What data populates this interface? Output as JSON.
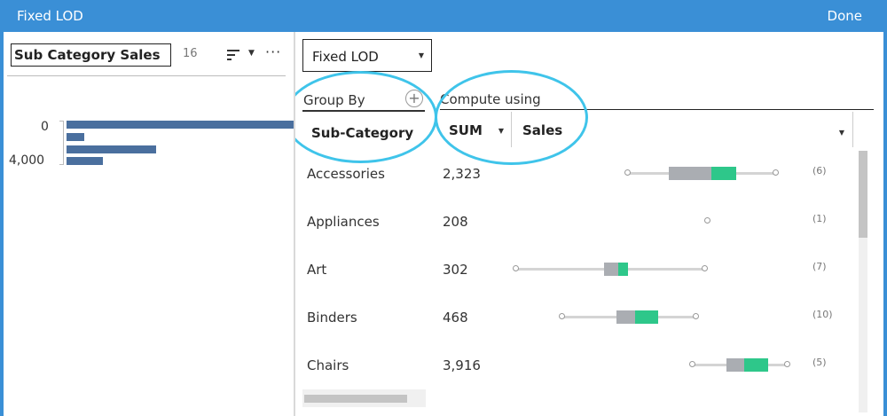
{
  "window": {
    "title": "Fixed LOD",
    "done_label": "Done"
  },
  "left_panel": {
    "field_name": "Sub Category Sales",
    "count": "16",
    "histogram": {
      "tick_labels": [
        "0",
        "4,000"
      ]
    }
  },
  "right_panel": {
    "lod_type": {
      "selected": "Fixed LOD"
    },
    "group_by": {
      "label": "Group By",
      "add_icon": "plus-circle-icon",
      "field": "Sub-Category"
    },
    "compute_using": {
      "label": "Compute using",
      "aggregation": "SUM",
      "field": "Sales"
    },
    "rows": [
      {
        "category": "Accessories",
        "value": "2,323",
        "count": "(6)"
      },
      {
        "category": "Appliances",
        "value": "208",
        "count": "(1)"
      },
      {
        "category": "Art",
        "value": "302",
        "count": "(7)"
      },
      {
        "category": "Binders",
        "value": "468",
        "count": "(10)"
      },
      {
        "category": "Chairs",
        "value": "3,916",
        "count": "(5)"
      }
    ]
  },
  "colors": {
    "titlebar": "#3a8fd6",
    "histogram_bar": "#4a6f9e",
    "boxplot_grey": "#aaadb2",
    "boxplot_green": "#2ec78a",
    "highlight_circle": "#3fc4ea"
  }
}
